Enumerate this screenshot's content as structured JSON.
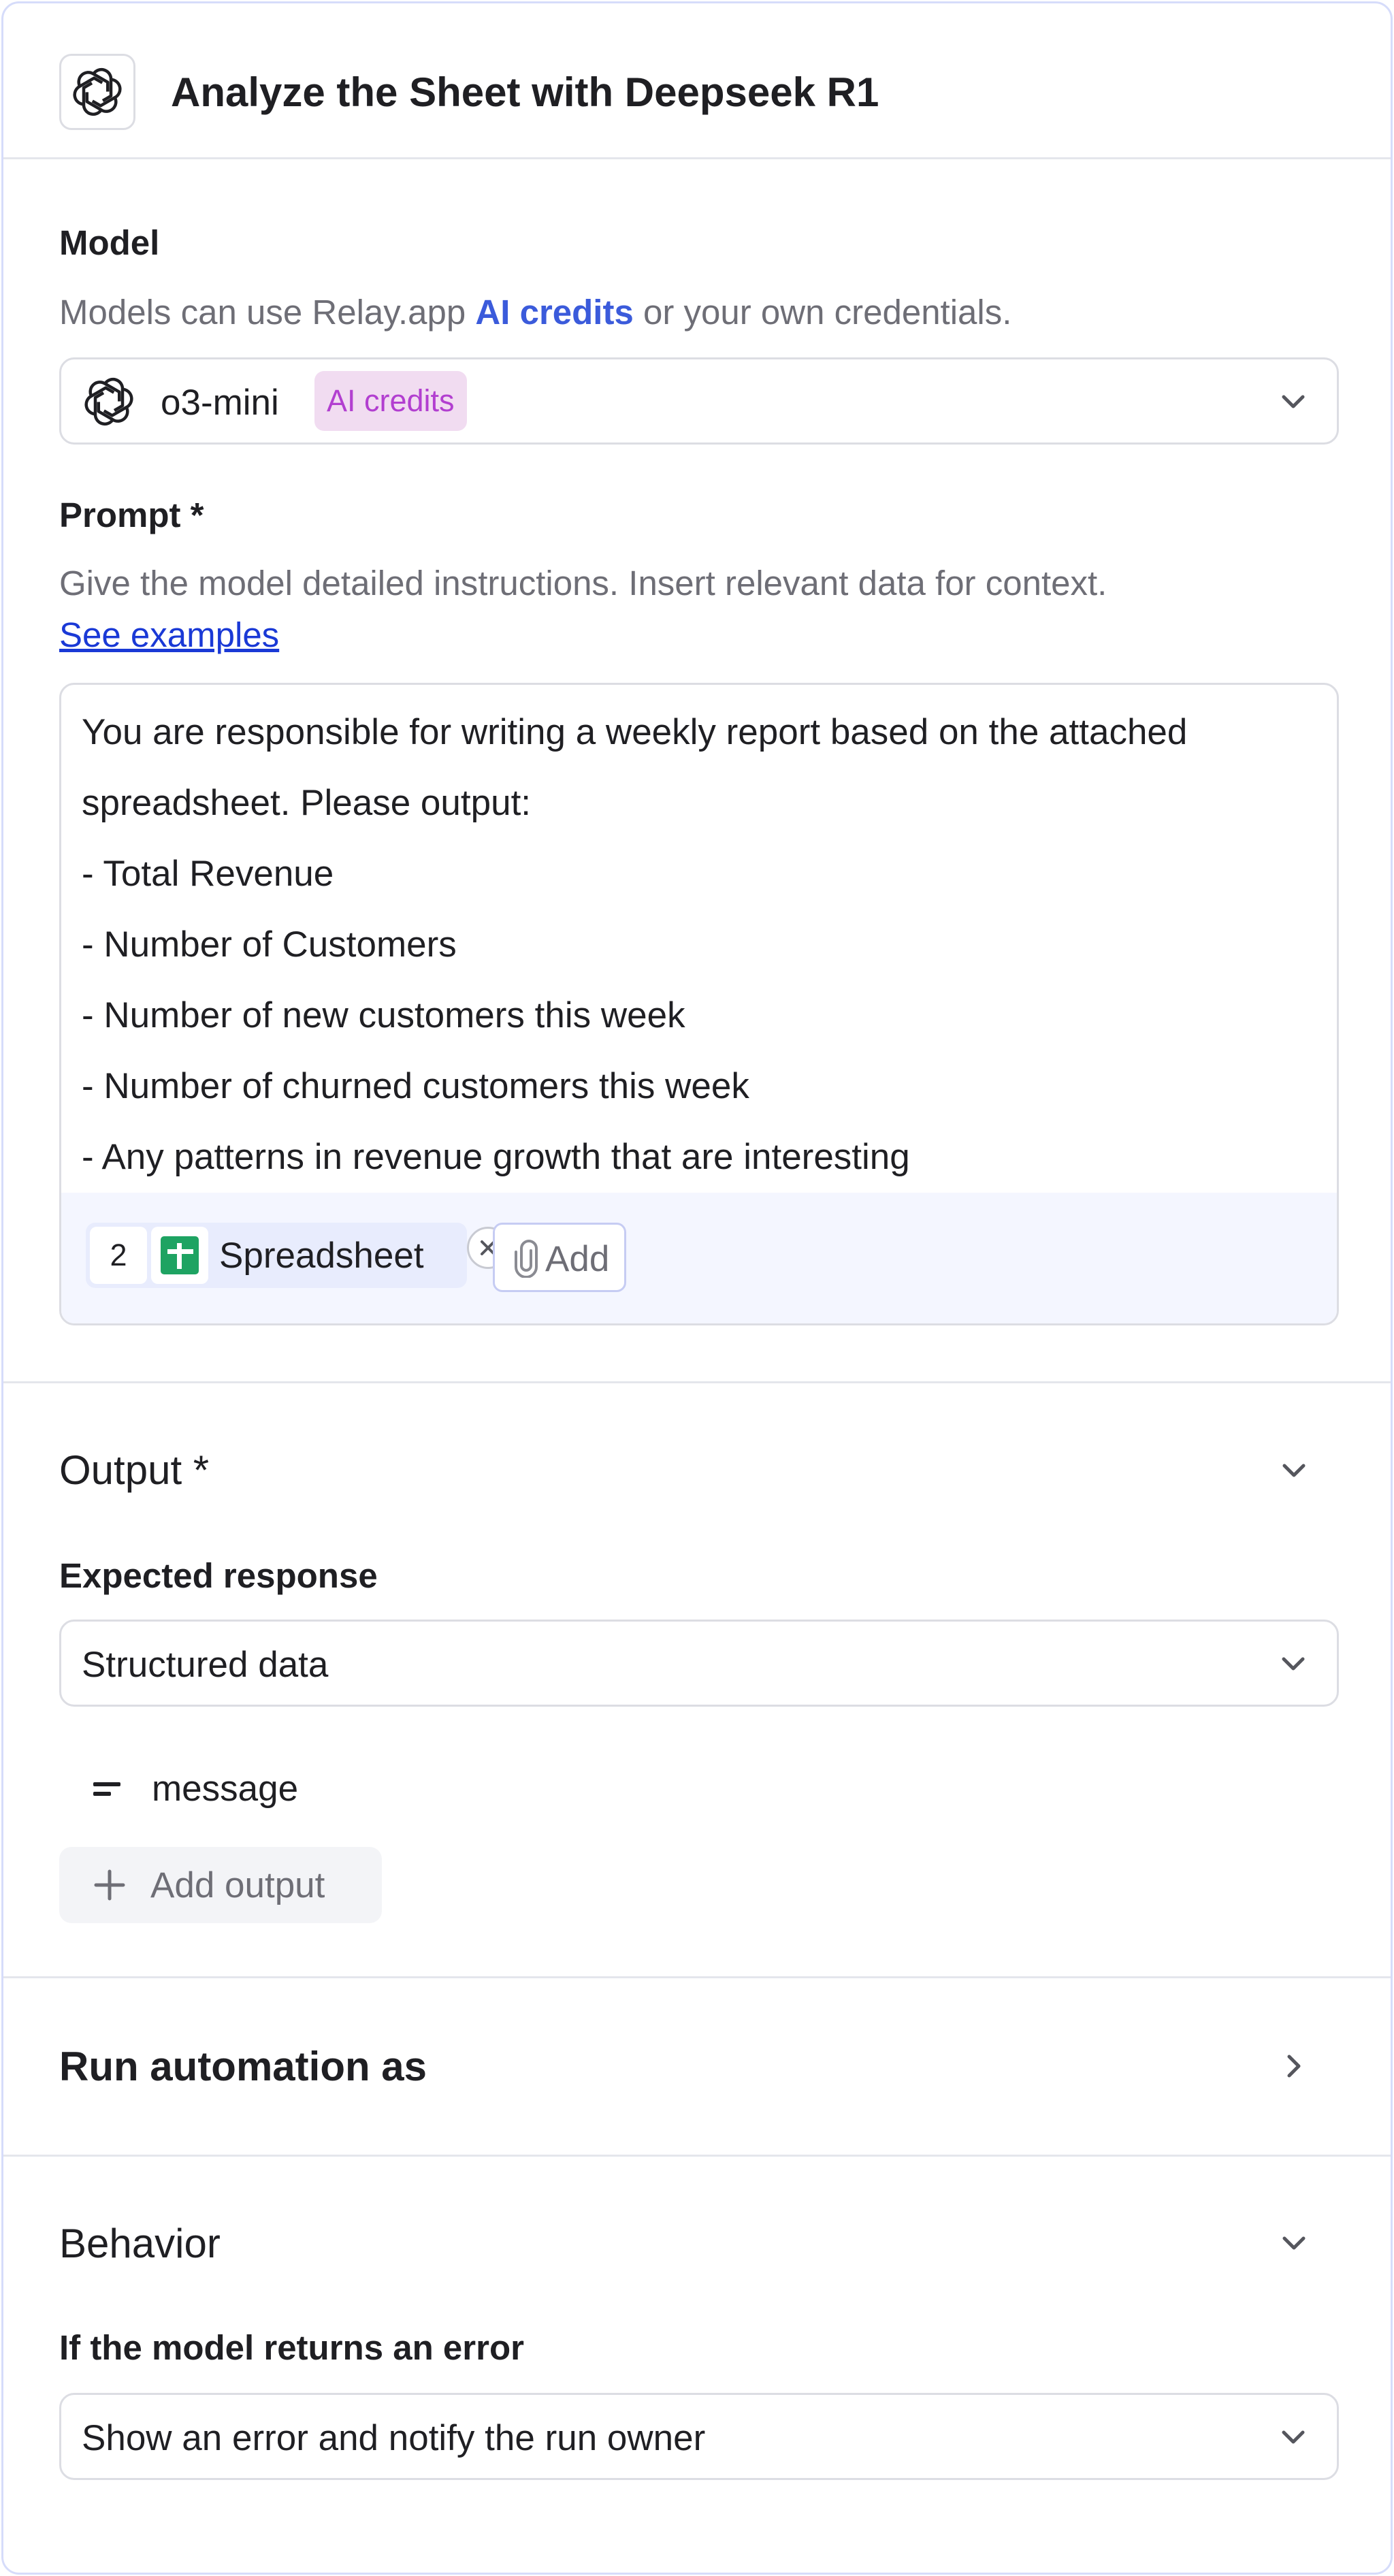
{
  "header": {
    "title": "Analyze the Sheet with Deepseek R1",
    "icon": "openai-icon"
  },
  "model": {
    "label": "Model",
    "help_prefix": "Models can use Relay.app ",
    "help_link": "AI credits",
    "help_suffix": " or your own credentials.",
    "selected": "o3-mini",
    "badge": "AI credits",
    "badge_color": "#b23fd0"
  },
  "prompt": {
    "label": "Prompt *",
    "help": "Give the model detailed instructions. Insert relevant data for context.",
    "examples_link": "See examples",
    "lines": [
      "You are responsible for writing a weekly report based on the attached",
      "spreadsheet. Please output:",
      "- Total Revenue",
      "- Number of Customers",
      "- Number of new customers this week",
      "- Number of churned customers this week",
      "- Any patterns in revenue growth that are interesting"
    ],
    "attachment": {
      "count": "2",
      "label": "Spreadsheet",
      "icon": "google-sheets-icon"
    },
    "add_label": "Add"
  },
  "output": {
    "title": "Output *",
    "expected_label": "Expected response",
    "expected_value": "Structured data",
    "fields": [
      {
        "name": "message",
        "icon": "text-field-icon"
      }
    ],
    "add_output_label": "Add output"
  },
  "run_as": {
    "title": "Run automation as"
  },
  "behavior": {
    "title": "Behavior",
    "error_label": "If the model returns an error",
    "error_value": "Show an error and notify the run owner"
  },
  "colors": {
    "accent_link": "#3b5bdb",
    "panel_border": "#d6dcfa"
  }
}
